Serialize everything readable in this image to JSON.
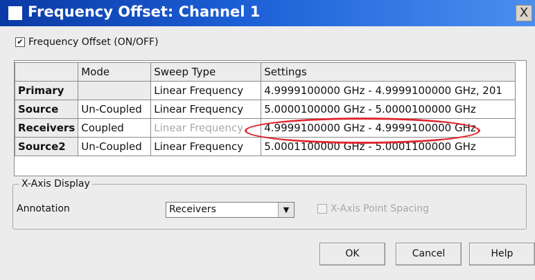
{
  "window": {
    "title": "Frequency Offset: Channel 1",
    "close_glyph": "X"
  },
  "onoff": {
    "checked_glyph": "✔",
    "label": "Frequency Offset (ON/OFF)"
  },
  "grid": {
    "headers": [
      "",
      "Mode",
      "Sweep Type",
      "Settings"
    ],
    "rows": [
      {
        "name": "Primary",
        "mode": "",
        "sweep": "Linear Frequency",
        "settings": "4.9999100000 GHz - 4.9999100000 GHz, 201"
      },
      {
        "name": "Source",
        "mode": "Un-Coupled",
        "sweep": "Linear Frequency",
        "settings": "5.0000100000 GHz - 5.0000100000 GHz"
      },
      {
        "name": "Receivers",
        "mode": "Coupled",
        "sweep": "Linear Frequency",
        "settings": "4.9999100000 GHz - 4.9999100000 GHz"
      },
      {
        "name": "Source2",
        "mode": "Un-Coupled",
        "sweep": "Linear Frequency",
        "settings": "5.0001100000 GHz - 5.0001100000 GHz"
      }
    ]
  },
  "xaxis": {
    "group_label": "X-Axis Display",
    "annotation_label": "Annotation",
    "annotation_value": "Receivers",
    "point_spacing_label": "X-Axis Point Spacing"
  },
  "buttons": {
    "ok": "OK",
    "cancel": "Cancel",
    "help": "Help"
  },
  "colors": {
    "title_bar": "#1c5fd6",
    "highlight": "#e0262e",
    "disabled_text": "#a8a8a8"
  }
}
